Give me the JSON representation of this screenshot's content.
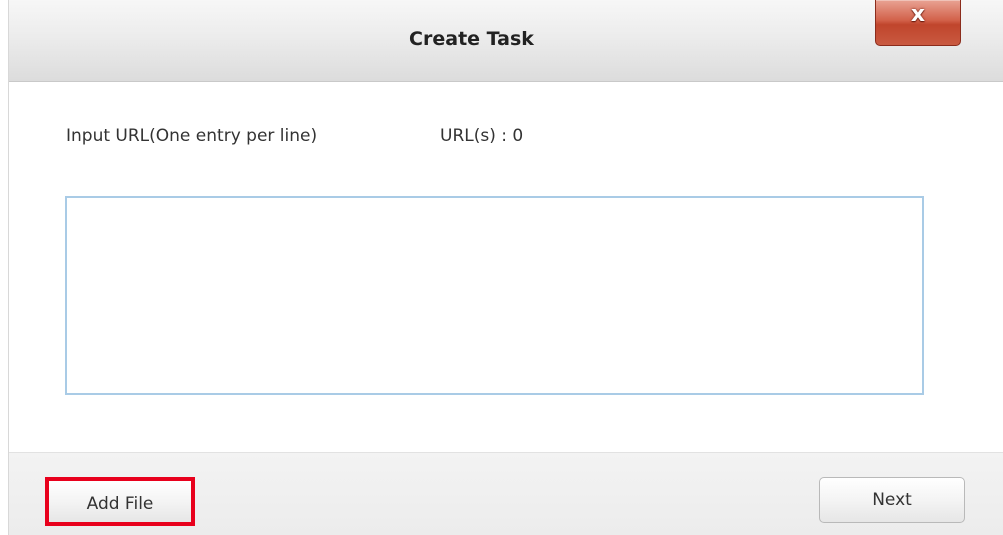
{
  "dialog": {
    "title": "Create Task",
    "close_glyph": "x",
    "close_icon": "close-icon"
  },
  "form": {
    "input_label": "Input URL(One entry per line)",
    "url_count": "URL(s) : 0",
    "textarea_value": ""
  },
  "footer": {
    "add_file_label": "Add File",
    "next_label": "Next"
  },
  "colors": {
    "highlight_border": "#e8001c",
    "textarea_border": "#a9cbe6",
    "close_button": "#c9573e"
  }
}
